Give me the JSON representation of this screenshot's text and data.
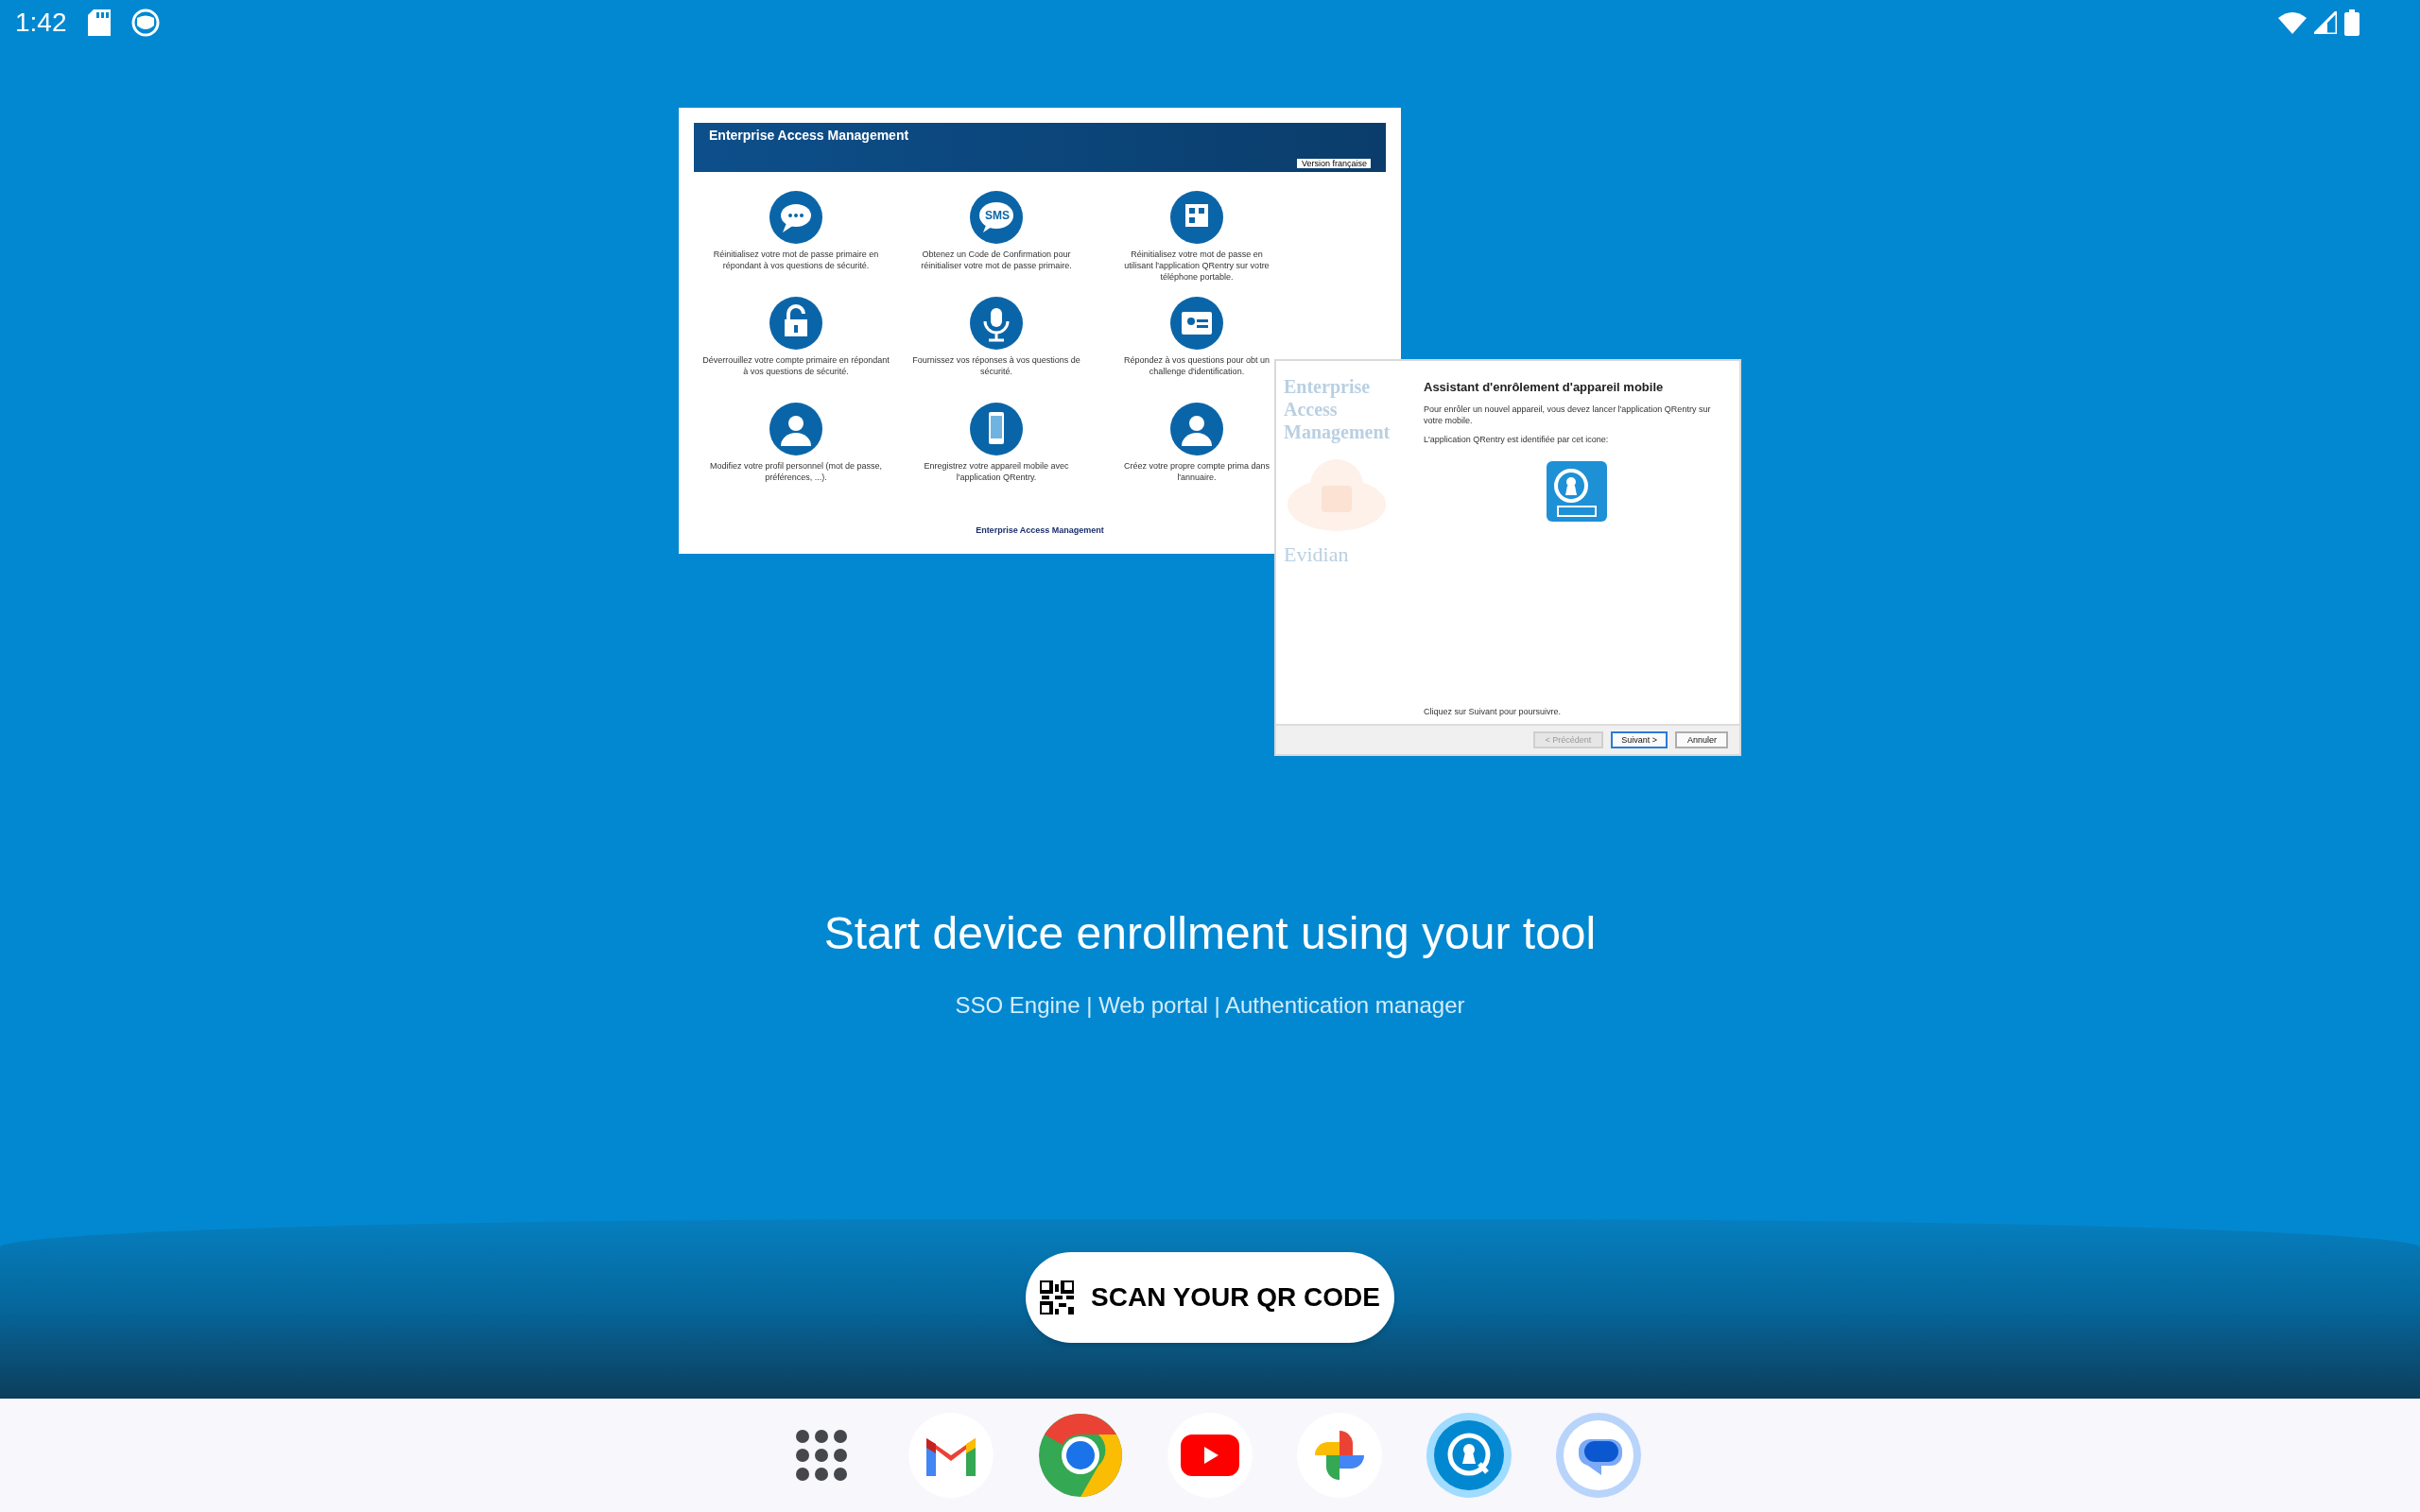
{
  "status_bar": {
    "time": "1:42",
    "left_icons": [
      {
        "kind": "sd"
      },
      {
        "kind": "face"
      }
    ],
    "right_icons": [
      {
        "kind": "wifi"
      },
      {
        "kind": "signal"
      },
      {
        "kind": "battery"
      }
    ]
  },
  "illustration": {
    "portal": {
      "title": "Enterprise Access Management",
      "language": "Version française",
      "sms_icon_text": "SMS",
      "items": [
        {
          "kind": "chat",
          "text": "Réinitialisez votre mot de passe primaire en répondant à vos questions de sécurité."
        },
        {
          "kind": "sms",
          "text": "Obtenez un Code de Confirmation pour réinitialiser votre mot de passe primaire."
        },
        {
          "kind": "qr",
          "text": "Réinitialisez votre mot de passe en utilisant l'application QRentry sur votre téléphone portable."
        },
        {
          "kind": "unlock",
          "text": "Déverrouillez votre compte primaire en répondant à vos questions de sécurité."
        },
        {
          "kind": "mic",
          "text": "Fournissez vos réponses à vos questions de sécurité."
        },
        {
          "kind": "idcard",
          "text": "Répondez à vos questions pour obt un challenge d'identification."
        },
        {
          "kind": "user",
          "text": "Modifiez votre profil personnel (mot de passe, préférences, ...)."
        },
        {
          "kind": "phone",
          "text": "Enregistrez votre appareil mobile avec l'application QRentry."
        },
        {
          "kind": "user",
          "text": "Créez votre propre compte prima dans l'annuaire."
        }
      ],
      "footer": "Enterprise Access Management"
    },
    "wizard": {
      "side_title": "Enterprise Access Management",
      "brand": "Evidian",
      "title": "Assistant d'enrôlement d'appareil mobile",
      "paragraphs": [
        "Pour enrôler un nouvel appareil, vous devez lancer l'application QRentry sur votre  mobile.",
        "L'application QRentry est identifiée par cet icone:"
      ],
      "footer_text": "Cliquez sur Suivant pour poursuivre.",
      "buttons": [
        {
          "label": "< Précédent",
          "disabled": true,
          "focused": false
        },
        {
          "label": "Suivant >",
          "disabled": false,
          "focused": true
        },
        {
          "label": "Annuler",
          "disabled": false,
          "focused": false
        }
      ]
    }
  },
  "title": "Start device enrollment using your tool",
  "subtitle": "SSO Engine | Web portal | Authentication manager",
  "scan_button": {
    "label": "SCAN YOUR QR CODE"
  },
  "dock": [
    {
      "kind": "apps"
    },
    {
      "kind": "mail"
    },
    {
      "kind": "browser"
    },
    {
      "kind": "video"
    },
    {
      "kind": "photos"
    },
    {
      "kind": "qrentry"
    },
    {
      "kind": "messages"
    }
  ]
}
